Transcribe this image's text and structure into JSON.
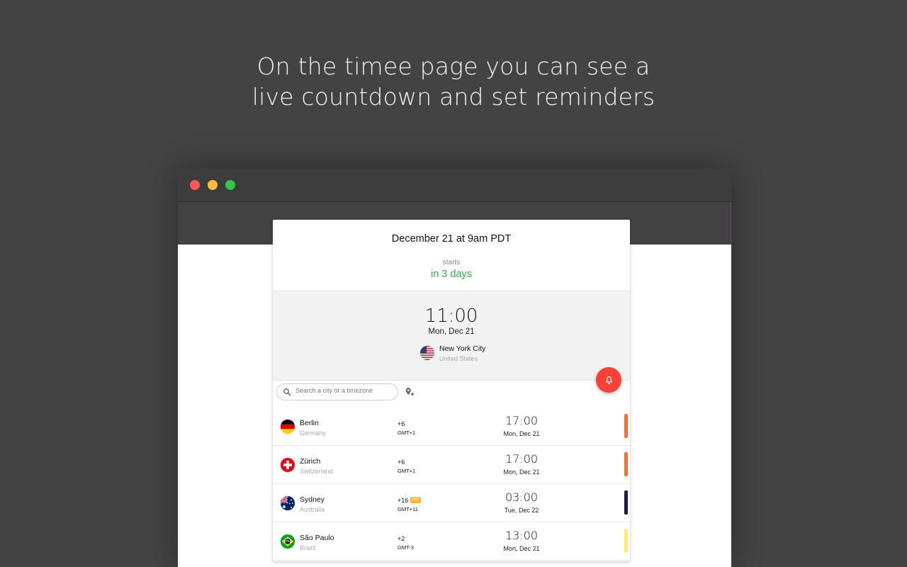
{
  "headline": {
    "line1": "On the timee page you can see a",
    "line2": "live countdown and set reminders"
  },
  "colors": {
    "background": "#434343",
    "accent_green": "#3aa64a",
    "fab_red": "#f44336",
    "traffic_red": "#fc5753",
    "traffic_yellow": "#fdbc40",
    "traffic_green": "#33c748"
  },
  "event": {
    "title": "December 21 at 9am PDT",
    "starts_label": "starts",
    "starts_value": "in 3 days"
  },
  "local": {
    "time": "11:00",
    "date": "Mon, Dec 21",
    "city": "New York City",
    "country": "United States",
    "flag_icon": "us-flag-icon"
  },
  "reminder_button_icon": "bell-icon",
  "search": {
    "placeholder": "Search a city or a timezone",
    "icon": "search-icon",
    "add_icon": "add-location-icon"
  },
  "cities": [
    {
      "city": "Berlin",
      "country": "Germany",
      "offset": "+6",
      "gmt": "GMT+1",
      "dst": "",
      "time": "17:00",
      "date": "Mon, Dec 21",
      "bar_color": "#ff6b35",
      "flag": "germany-flag-icon"
    },
    {
      "city": "Zürich",
      "country": "Switzerland",
      "offset": "+6",
      "gmt": "GMT+1",
      "dst": "",
      "time": "17:00",
      "date": "Mon, Dec 21",
      "bar_color": "#ff6b35",
      "flag": "switzerland-flag-icon"
    },
    {
      "city": "Sydney",
      "country": "Australia",
      "offset": "+16",
      "gmt": "GMT+11",
      "dst": "DST",
      "time": "03:00",
      "date": "Tue, Dec 22",
      "bar_color": "#1a1a4e",
      "flag": "australia-flag-icon"
    },
    {
      "city": "São Paulo",
      "country": "Brazil",
      "offset": "+2",
      "gmt": "GMT-3",
      "dst": "",
      "time": "13:00",
      "date": "Mon, Dec 21",
      "bar_color": "#f9ee72",
      "flag": "brazil-flag-icon"
    }
  ]
}
